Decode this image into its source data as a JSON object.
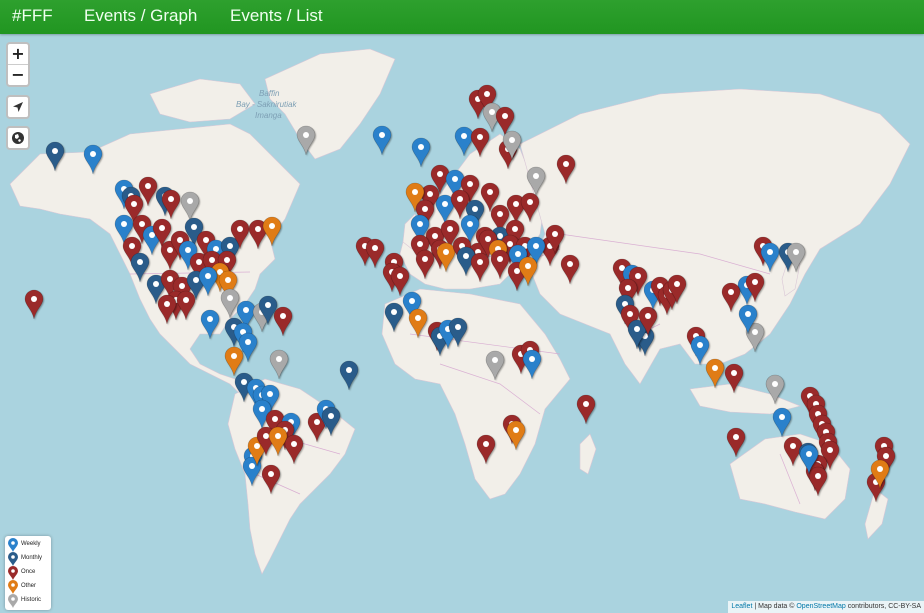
{
  "nav": {
    "brand": "#FFF",
    "links": [
      "Events / Graph",
      "Events / List"
    ]
  },
  "controls": {
    "zoom_in": "+",
    "zoom_out": "−",
    "locate_icon": "location-arrow-icon",
    "layers_icon": "globe-icon"
  },
  "map": {
    "labels": [
      {
        "text": "Baffin"
      },
      {
        "text": "Bay - Saknirutiak"
      },
      {
        "text": "Imanga"
      }
    ]
  },
  "legend": [
    {
      "label": "Weekly",
      "color": "#2a81cb"
    },
    {
      "label": "Monthly",
      "color": "#2a5c8a"
    },
    {
      "label": "Once",
      "color": "#9a2a2a"
    },
    {
      "label": "Other",
      "color": "#e07b14"
    },
    {
      "label": "Historic",
      "color": "#a9a9a9"
    }
  ],
  "attribution": {
    "leaflet": "Leaflet",
    "separator": " | Map data © ",
    "osm": "OpenStreetMap",
    "rest": " contributors, CC-BY-SA"
  }
}
